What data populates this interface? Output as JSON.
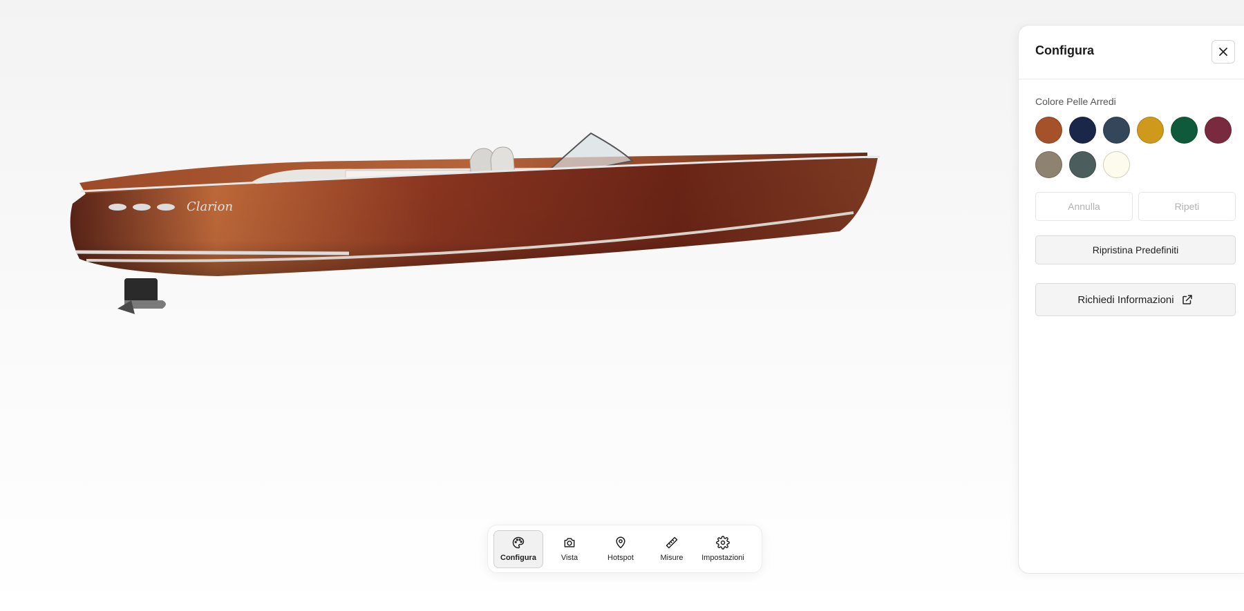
{
  "toolbar": {
    "items": [
      {
        "label": "Configura",
        "icon": "palette-icon",
        "active": true
      },
      {
        "label": "Vista",
        "icon": "camera-icon",
        "active": false
      },
      {
        "label": "Hotspot",
        "icon": "map-pin-icon",
        "active": false
      },
      {
        "label": "Misure",
        "icon": "ruler-icon",
        "active": false
      },
      {
        "label": "Impostazioni",
        "icon": "gear-icon",
        "active": false
      }
    ]
  },
  "panel": {
    "title": "Configura",
    "close_icon": "close-icon",
    "section_label": "Colore Pelle Arredi",
    "swatches": [
      {
        "color": "#a5512a",
        "selected": false
      },
      {
        "color": "#1b2748",
        "selected": false
      },
      {
        "color": "#34465a",
        "selected": false
      },
      {
        "color": "#cf9a1b",
        "selected": false
      },
      {
        "color": "#0e5a3a",
        "selected": false
      },
      {
        "color": "#7a2a3f",
        "selected": false
      },
      {
        "color": "#8e8371",
        "selected": false
      },
      {
        "color": "#4c5d5d",
        "selected": false
      },
      {
        "color": "#fdfcec",
        "selected": false
      }
    ],
    "undo_label": "Annulla",
    "redo_label": "Ripeti",
    "reset_label": "Ripristina Predefiniti",
    "info_label": "Richiedi Informazioni",
    "info_icon": "external-link-icon"
  },
  "boat": {
    "name_script": "Clarion",
    "hull_color": "#7a2e1a",
    "deck_color": "#d9d9d9"
  }
}
